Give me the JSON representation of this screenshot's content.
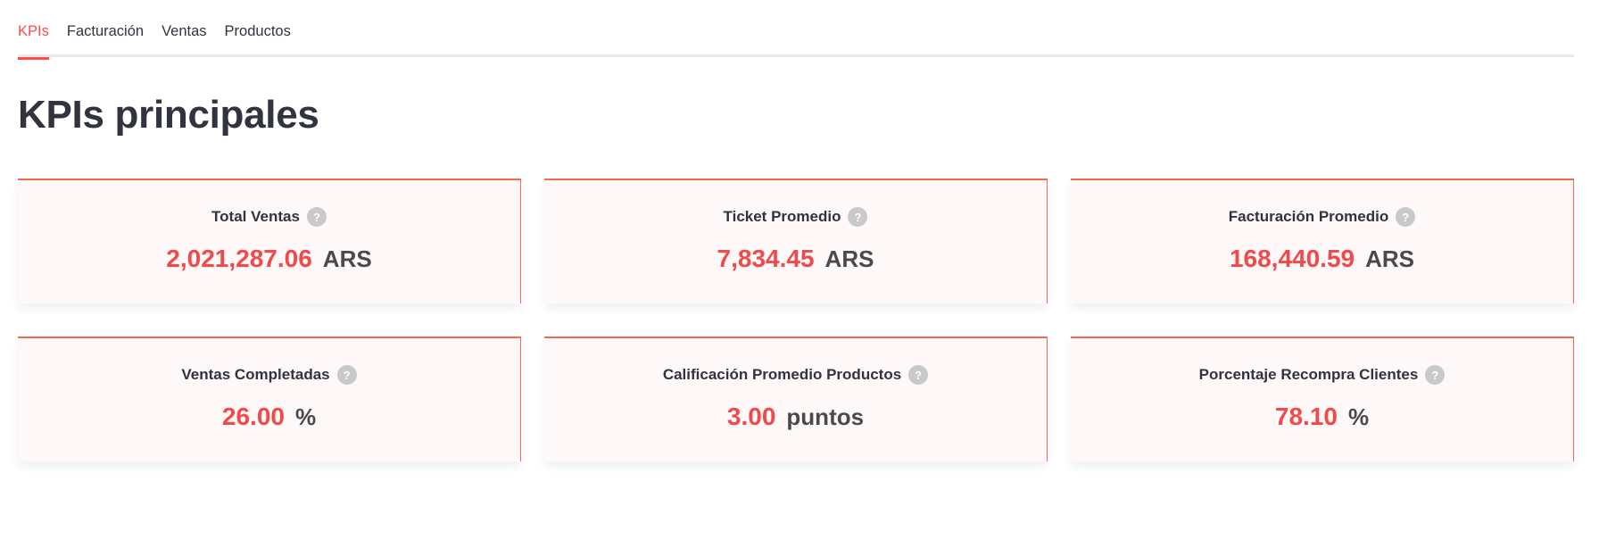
{
  "tabs": [
    {
      "label": "KPIs",
      "active": true
    },
    {
      "label": "Facturación",
      "active": false
    },
    {
      "label": "Ventas",
      "active": false
    },
    {
      "label": "Productos",
      "active": false
    }
  ],
  "page_title": "KPIs principales",
  "help_icon_glyph": "?",
  "colors": {
    "accent": "#ff4b4b",
    "value": "#f04a4a",
    "card_border": "#f26b4f",
    "card_bg": "#fff8f8",
    "text": "#31333f"
  },
  "cards": [
    {
      "label": "Total Ventas",
      "value": "2,021,287.06",
      "unit": "ARS",
      "icon": "help-icon"
    },
    {
      "label": "Ticket Promedio",
      "value": "7,834.45",
      "unit": "ARS",
      "icon": "help-icon"
    },
    {
      "label": "Facturación Promedio",
      "value": "168,440.59",
      "unit": "ARS",
      "icon": "help-icon"
    },
    {
      "label": "Ventas Completadas",
      "value": "26.00",
      "unit": "%",
      "icon": "help-icon"
    },
    {
      "label": "Calificación Promedio Productos",
      "value": "3.00",
      "unit": "puntos",
      "icon": "help-icon"
    },
    {
      "label": "Porcentaje Recompra Clientes",
      "value": "78.10",
      "unit": "%",
      "icon": "help-icon"
    }
  ]
}
